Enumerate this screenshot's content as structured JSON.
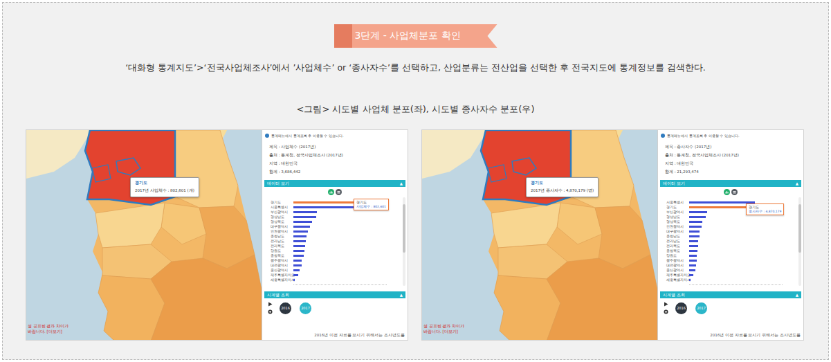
{
  "step_label": "3단계 - 사업체분포 확인",
  "instruction": "‘대화형 통계지도’>‘전국사업체조사’에서 ’사업체수’ or ‘종사자수’를 선택하고, 산업분류는 전산업을 선택한 후 전국지도에 통계정보를 검색한다.",
  "caption": "<그림> 시도별 사업체 분포(좌), 시도별 종사자수 분포(우)",
  "screens": [
    {
      "map": {
        "tooltip": {
          "title": "경기도",
          "text": "2017년 사업체수 : 802,601 (개)"
        },
        "notice": [
          "설 공표된 결과 차이가",
          "바랍니다. [더보기]"
        ]
      },
      "panel": {
        "info": "통계메뉴에서 통계조회 후 이용할 수 있습니다.",
        "meta": [
          "제목 : 사업체수 (2017년)",
          "출처 : 통계청, 전국사업체조사 (2017년)",
          "지역 : 대한민국",
          "합계 : 3,686,442"
        ],
        "data_header": "데이터 보기",
        "data_arrow": "▲",
        "view_toggle": [
          {
            "kind": "chart",
            "selected": true
          },
          {
            "kind": "table",
            "selected": false
          }
        ],
        "chart": {
          "bars": [
            {
              "label": "경기도",
              "value": 802601,
              "selected": true
            },
            {
              "label": "서울특별시",
              "value": 781000,
              "selected": false
            },
            {
              "label": "부산광역시",
              "value": 285000,
              "selected": false
            },
            {
              "label": "경상남도",
              "value": 275000,
              "selected": false
            },
            {
              "label": "경상북도",
              "value": 230000,
              "selected": false
            },
            {
              "label": "대구광역시",
              "value": 200000,
              "selected": false
            },
            {
              "label": "인천광역시",
              "value": 180000,
              "selected": false
            },
            {
              "label": "충청남도",
              "value": 160000,
              "selected": false
            },
            {
              "label": "전라남도",
              "value": 150000,
              "selected": false
            },
            {
              "label": "전라북도",
              "value": 145000,
              "selected": false
            },
            {
              "label": "강원도",
              "value": 135000,
              "selected": false
            },
            {
              "label": "충청북도",
              "value": 125000,
              "selected": false
            },
            {
              "label": "광주광역시",
              "value": 100000,
              "selected": false
            },
            {
              "label": "대전광역시",
              "value": 98000,
              "selected": false
            },
            {
              "label": "울산광역시",
              "value": 75000,
              "selected": false
            },
            {
              "label": "제주특별자치도",
              "value": 58000,
              "selected": false
            },
            {
              "label": "세종특별자치시",
              "value": 13000,
              "selected": false
            }
          ],
          "tooltip": {
            "title": "경기도",
            "text": "사업체수 : 802,601"
          }
        },
        "series_header": "시계열 조회",
        "series_arrow": "▲",
        "years": [
          {
            "label": "2016",
            "selected": false
          },
          {
            "label": "2017",
            "selected": true
          }
        ],
        "footer": "2016년 이전 자료를 보시기 위해서는 조사년도를"
      }
    },
    {
      "map": {
        "tooltip": {
          "title": "경기도",
          "text": "2017년 종사자수 : 4,870,179 (명)"
        },
        "notice": [
          "설 공표된 결과 차이가",
          "바랍니다. [더보기]"
        ]
      },
      "panel": {
        "info": "통계메뉴에서 통계조회 후 이용할 수 있습니다.",
        "meta": [
          "제목 : 종사자수 (2017년)",
          "출처 : 통계청, 전국사업체조사 (2017년)",
          "지역 : 대한민국",
          "합계 : 21,293,474"
        ],
        "data_header": "데이터 보기",
        "data_arrow": "▲",
        "view_toggle": [
          {
            "kind": "chart",
            "selected": true
          },
          {
            "kind": "table",
            "selected": false
          }
        ],
        "chart": {
          "bars": [
            {
              "label": "서울특별시",
              "value": 5140000,
              "selected": false
            },
            {
              "label": "경기도",
              "value": 4870179,
              "selected": true
            },
            {
              "label": "부산광역시",
              "value": 1380000,
              "selected": false
            },
            {
              "label": "경상남도",
              "value": 1300000,
              "selected": false
            },
            {
              "label": "경상북도",
              "value": 1050000,
              "selected": false
            },
            {
              "label": "인천광역시",
              "value": 980000,
              "selected": false
            },
            {
              "label": "대구광역시",
              "value": 830000,
              "selected": false
            },
            {
              "label": "충청남도",
              "value": 820000,
              "selected": false
            },
            {
              "label": "전라남도",
              "value": 700000,
              "selected": false
            },
            {
              "label": "전라북도",
              "value": 680000,
              "selected": false
            },
            {
              "label": "충청북도",
              "value": 640000,
              "selected": false
            },
            {
              "label": "강원도",
              "value": 600000,
              "selected": false
            },
            {
              "label": "광주광역시",
              "value": 580000,
              "selected": false
            },
            {
              "label": "대전광역시",
              "value": 560000,
              "selected": false
            },
            {
              "label": "울산광역시",
              "value": 500000,
              "selected": false
            },
            {
              "label": "제주특별자치도",
              "value": 300000,
              "selected": false
            },
            {
              "label": "세종특별자치시",
              "value": 110000,
              "selected": false
            }
          ],
          "tooltip": {
            "title": "경기도",
            "text": "종사자수 : 4,870,179"
          }
        },
        "series_header": "시계열 조회",
        "series_arrow": "▲",
        "years": [
          {
            "label": "2016",
            "selected": false
          },
          {
            "label": "2017",
            "selected": true
          }
        ],
        "footer": "2016년 이전 자료를 보시기 위해서는 조사년도를"
      }
    }
  ]
}
